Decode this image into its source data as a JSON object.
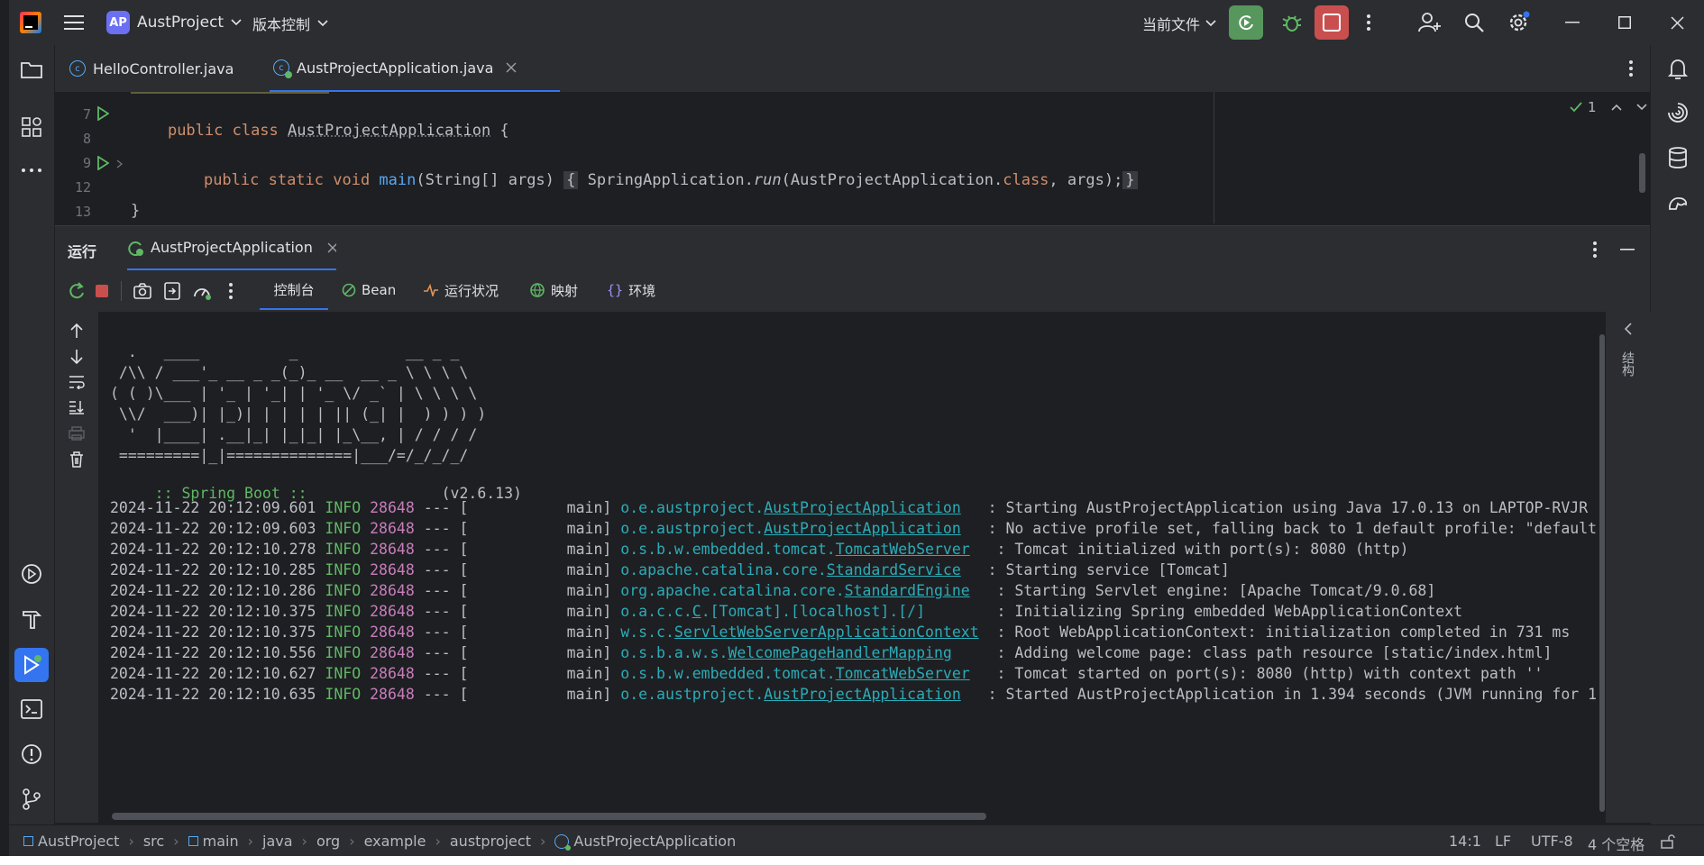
{
  "titlebar": {
    "project_badge": "AP",
    "project_name": "AustProject",
    "vcs_label": "版本控制",
    "run_config": "当前文件"
  },
  "tabs": [
    {
      "label": "HelloController.java"
    },
    {
      "label": "AustProjectApplication.java"
    }
  ],
  "editor": {
    "gutter": [
      "7",
      "8",
      "9",
      "12",
      "13"
    ],
    "line7": {
      "kw": "public class ",
      "name": "AustProjectApplication",
      "rest": " {"
    },
    "line9": {
      "kw": "public static void ",
      "fn": "main",
      "args": "(String[] args)",
      "open": "{",
      "body_a": " SpringApplication.",
      "run": "run",
      "body_b": "(AustProjectApplication.",
      "cls": "class",
      "body_c": ", args);",
      "close": "}"
    },
    "line13": "}",
    "inspections": "1"
  },
  "run_panel": {
    "title": "运行",
    "tab_label": "AustProjectApplication",
    "toolbar_tabs": [
      "控制台",
      "Bean",
      "运行状况",
      "映射",
      "环境"
    ],
    "right_label": "结构"
  },
  "console": {
    "banner": [
      "  .   ____          _            __ _ _",
      " /\\\\ / ___'_ __ _ _(_)_ __  __ _ \\ \\ \\ \\",
      "( ( )\\___ | '_ | '_| | '_ \\/ _` | \\ \\ \\ \\",
      " \\\\/  ___)| |_)| | | | | || (_| |  ) ) ) )",
      "  '  |____| .__|_| |_|_| |_\\__, | / / / /",
      " =========|_|==============|___/=/_/_/_/"
    ],
    "boot_label": " :: Spring Boot ::",
    "boot_version": "(v2.6.13)",
    "logs": [
      {
        "ts": "2024-11-22 20:12:09.601",
        "level": "INFO",
        "pid": "28648",
        "thread": "--- [           main]",
        "pkg": "o.e.austproject.",
        "cls": "AustProjectApplication",
        "pad": "  ",
        "msg": ": Starting AustProjectApplication using Java 17.0.13 on LAPTOP-RVJR"
      },
      {
        "ts": "2024-11-22 20:12:09.603",
        "level": "INFO",
        "pid": "28648",
        "thread": "--- [           main]",
        "pkg": "o.e.austproject.",
        "cls": "AustProjectApplication",
        "pad": "  ",
        "msg": ": No active profile set, falling back to 1 default profile: \"default"
      },
      {
        "ts": "2024-11-22 20:12:10.278",
        "level": "INFO",
        "pid": "28648",
        "thread": "--- [           main]",
        "pkg": "o.s.b.w.embedded.tomcat.",
        "cls": "TomcatWebServer",
        "pad": "  ",
        "msg": ": Tomcat initialized with port(s): 8080 (http)"
      },
      {
        "ts": "2024-11-22 20:12:10.285",
        "level": "INFO",
        "pid": "28648",
        "thread": "--- [           main]",
        "pkg": "o.apache.catalina.core.",
        "cls": "StandardService",
        "pad": "  ",
        "msg": ": Starting service [Tomcat]"
      },
      {
        "ts": "2024-11-22 20:12:10.286",
        "level": "INFO",
        "pid": "28648",
        "thread": "--- [           main]",
        "pkg": "org.apache.catalina.core.",
        "cls": "StandardEngine",
        "pad": "  ",
        "msg": ": Starting Servlet engine: [Apache Tomcat/9.0.68]"
      },
      {
        "ts": "2024-11-22 20:12:10.375",
        "level": "INFO",
        "pid": "28648",
        "thread": "--- [           main]",
        "pkg": "o.a.c.c.",
        "cls": "C",
        "pad": ".[Tomcat].[localhost].[/]       ",
        "msg": ": Initializing Spring embedded WebApplicationContext"
      },
      {
        "ts": "2024-11-22 20:12:10.375",
        "level": "INFO",
        "pid": "28648",
        "thread": "--- [           main]",
        "pkg": "w.s.c.",
        "cls": "ServletWebServerApplicationContext",
        "pad": " ",
        "msg": ": Root WebApplicationContext: initialization completed in 731 ms"
      },
      {
        "ts": "2024-11-22 20:12:10.556",
        "level": "INFO",
        "pid": "28648",
        "thread": "--- [           main]",
        "pkg": "o.s.b.a.w.s.",
        "cls": "WelcomePageHandlerMapping",
        "pad": "    ",
        "msg": ": Adding welcome page: class path resource [static/index.html]"
      },
      {
        "ts": "2024-11-22 20:12:10.627",
        "level": "INFO",
        "pid": "28648",
        "thread": "--- [           main]",
        "pkg": "o.s.b.w.embedded.tomcat.",
        "cls": "TomcatWebServer",
        "pad": "  ",
        "msg": ": Tomcat started on port(s): 8080 (http) with context path ''"
      },
      {
        "ts": "2024-11-22 20:12:10.635",
        "level": "INFO",
        "pid": "28648",
        "thread": "--- [           main]",
        "pkg": "o.e.austproject.",
        "cls": "AustProjectApplication",
        "pad": "  ",
        "msg": ": Started AustProjectApplication in 1.394 seconds (JVM running for 1"
      }
    ]
  },
  "statusbar": {
    "breadcrumb": [
      "AustProject",
      "src",
      "main",
      "java",
      "org",
      "example",
      "austproject",
      "AustProjectApplication"
    ],
    "position": "14:1",
    "line_sep": "LF",
    "encoding": "UTF-8",
    "indent": "4 个空格"
  },
  "colors": {
    "accent": "#3574f0",
    "run_green": "#57965c",
    "stop_red": "#c94f4f"
  }
}
